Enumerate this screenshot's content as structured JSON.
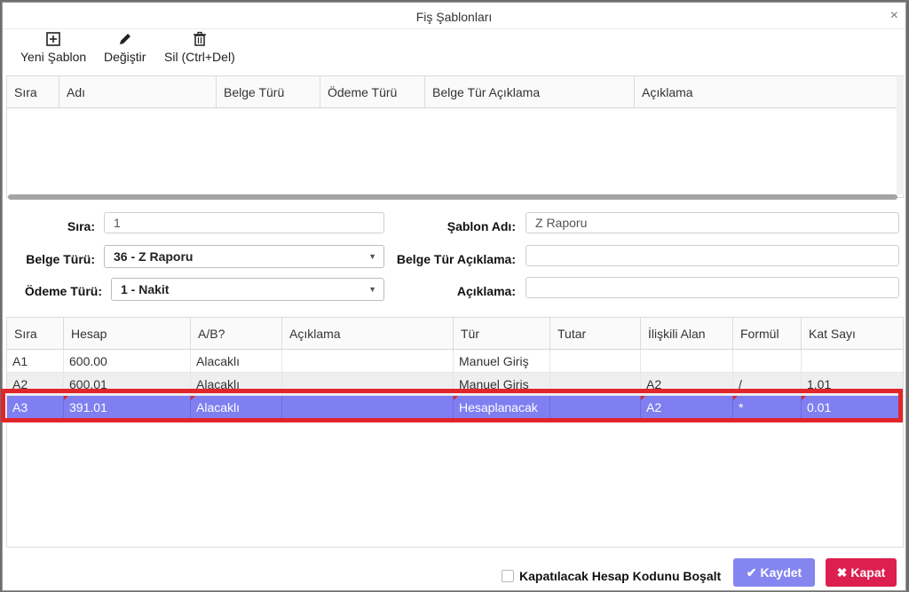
{
  "dialog": {
    "title": "Fiş Şablonları",
    "close_glyph": "×"
  },
  "toolbar": {
    "new_label": "Yeni Şablon",
    "edit_label": "Değiştir",
    "delete_label": "Sil (Ctrl+Del)"
  },
  "templates_grid": {
    "columns": [
      "Sıra",
      "Adı",
      "Belge Türü",
      "Ödeme Türü",
      "Belge Tür Açıklama",
      "Açıklama"
    ]
  },
  "form": {
    "sira_label": "Sıra:",
    "sira_value": "1",
    "belge_turu_label": "Belge Türü:",
    "belge_turu_value": "36 - Z Raporu",
    "odeme_turu_label": "Ödeme Türü:",
    "odeme_turu_value": "1 - Nakit",
    "sablon_adi_label": "Şablon Adı:",
    "sablon_adi_value": "Z Raporu",
    "belge_tur_aciklama_label": "Belge Tür Açıklama:",
    "belge_tur_aciklama_value": "",
    "aciklama_label": "Açıklama:",
    "aciklama_value": ""
  },
  "lines_grid": {
    "columns": [
      "Sıra",
      "Hesap",
      "A/B?",
      "Açıklama",
      "Tür",
      "Tutar",
      "İlişkili Alan",
      "Formül",
      "Kat Sayı"
    ],
    "rows": [
      [
        "A1",
        "600.00",
        "Alacaklı",
        "",
        "Manuel Giriş",
        "",
        "",
        "",
        ""
      ],
      [
        "A2",
        "600.01",
        "Alacaklı",
        "",
        "Manuel Giriş",
        "",
        "A2",
        "/",
        "1.01"
      ],
      [
        "A3",
        "391.01",
        "Alacaklı",
        "",
        "Hesaplanacak",
        "",
        "A2",
        "*",
        "0.01"
      ]
    ]
  },
  "footer": {
    "checkbox_label": "Kapatılacak Hesap Kodunu Boşalt",
    "save_label": "Kaydet",
    "close_label": "Kapat"
  },
  "colors": {
    "selected_row": "#7f7ff2",
    "highlight": "#e0262b",
    "save_button": "#8585f0",
    "close_button": "#dc1f4e"
  }
}
